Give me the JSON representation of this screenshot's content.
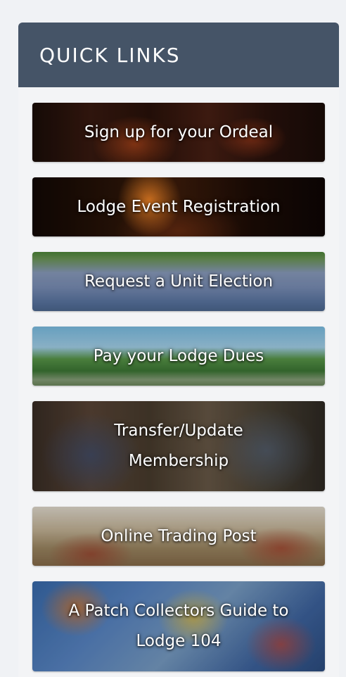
{
  "widget": {
    "title": "QUICK LINKS"
  },
  "links": [
    {
      "label": "Sign up for your Ordeal"
    },
    {
      "label": "Lodge Event Registration"
    },
    {
      "label": "Request a Unit Election"
    },
    {
      "label": "Pay your Lodge Dues"
    },
    {
      "label": "Transfer/Update Membership"
    },
    {
      "label": "Online Trading Post"
    },
    {
      "label": "A Patch Collectors Guide to Lodge 104"
    }
  ],
  "colors": {
    "header_bg": "#455467",
    "page_bg": "#f0f2f5",
    "label_text": "#ffffff"
  }
}
